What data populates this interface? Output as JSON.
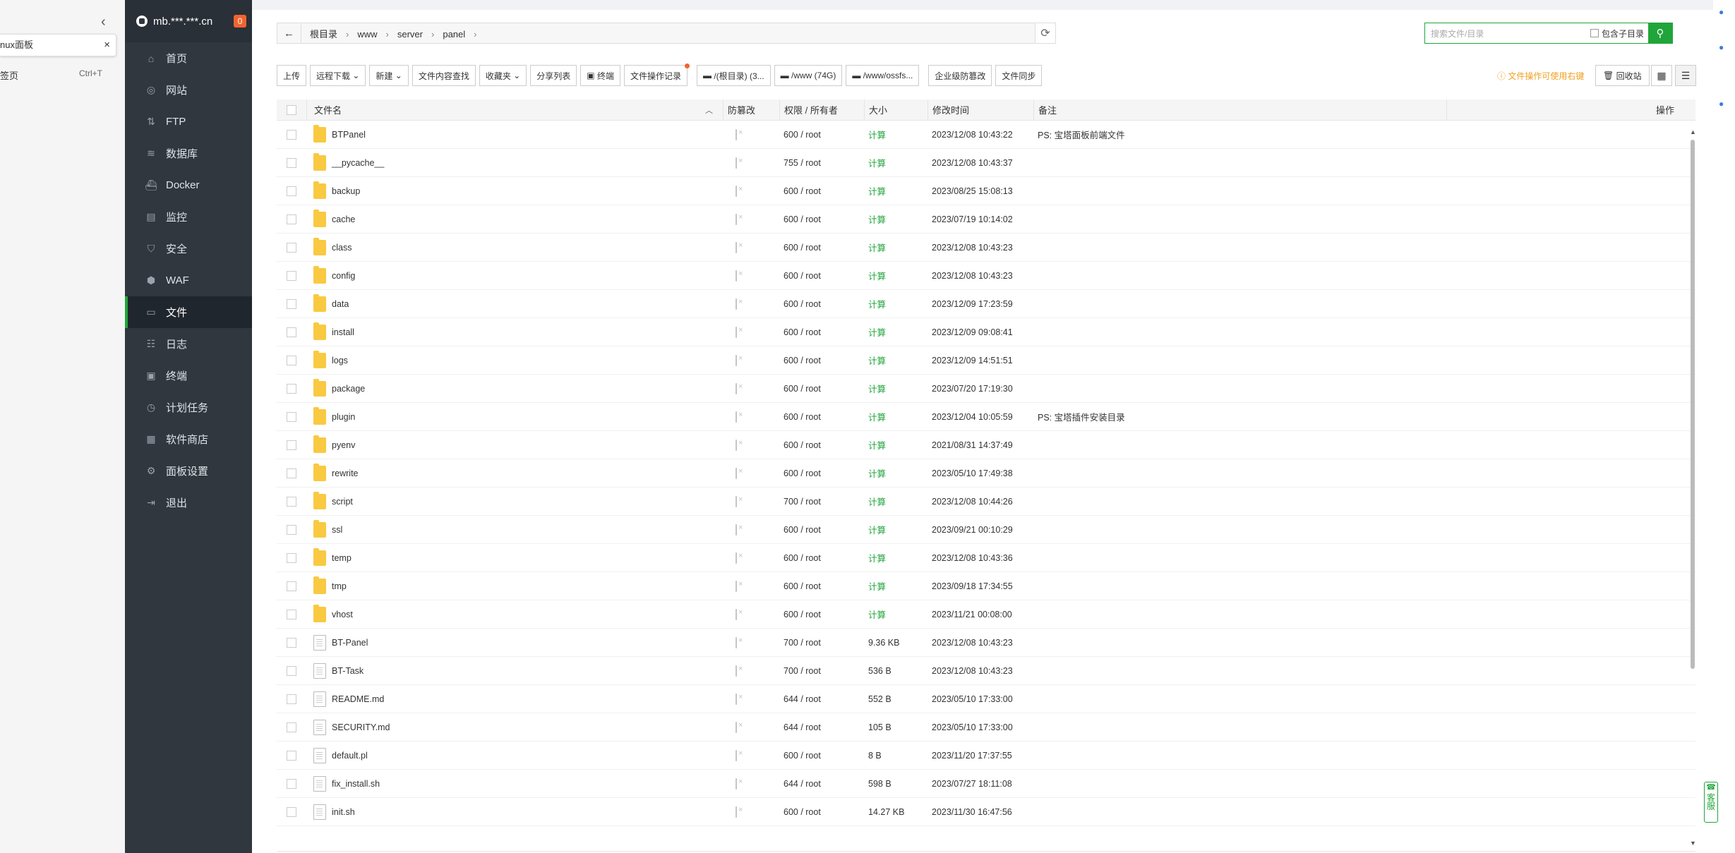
{
  "browser": {
    "tab_title": "nux面板",
    "new_tab_label": "签页",
    "new_tab_shortcut": "Ctrl+T"
  },
  "sidebar": {
    "host": "mb.***.***.cn",
    "badge": "0",
    "items": [
      {
        "label": "首页",
        "icon": "home-icon"
      },
      {
        "label": "网站",
        "icon": "globe-icon"
      },
      {
        "label": "FTP",
        "icon": "ftp-icon"
      },
      {
        "label": "数据库",
        "icon": "database-icon"
      },
      {
        "label": "Docker",
        "icon": "docker-icon"
      },
      {
        "label": "监控",
        "icon": "monitor-icon"
      },
      {
        "label": "安全",
        "icon": "shield-icon"
      },
      {
        "label": "WAF",
        "icon": "waf-icon"
      },
      {
        "label": "文件",
        "icon": "folder-icon",
        "active": true
      },
      {
        "label": "日志",
        "icon": "log-icon"
      },
      {
        "label": "终端",
        "icon": "terminal-icon"
      },
      {
        "label": "计划任务",
        "icon": "clock-icon"
      },
      {
        "label": "软件商店",
        "icon": "grid-icon"
      },
      {
        "label": "面板设置",
        "icon": "gear-icon"
      },
      {
        "label": "退出",
        "icon": "logout-icon"
      }
    ]
  },
  "breadcrumb": [
    "根目录",
    "www",
    "server",
    "panel"
  ],
  "search": {
    "placeholder": "搜索文件/目录",
    "subdir_label": "包含子目录"
  },
  "toolbar": {
    "upload": "上传",
    "remote_download": "远程下载",
    "new": "新建",
    "content_search": "文件内容查找",
    "favorites": "收藏夹",
    "share_list": "分享列表",
    "terminal": "终端",
    "op_log": "文件操作记录",
    "disk_root": "/(根目录) (3...",
    "disk_www": "/www (74G)",
    "disk_oss": "/www/ossfs...",
    "tamper": "企业级防篡改",
    "sync": "文件同步",
    "tips": "文件操作可使用右键",
    "recycle": "回收站"
  },
  "table": {
    "headers": {
      "name": "文件名",
      "protect": "防篡改",
      "perm": "权限 / 所有者",
      "size": "大小",
      "mtime": "修改时间",
      "note": "备注",
      "op": "操作"
    },
    "rows": [
      {
        "type": "folder",
        "name": "BTPanel",
        "perm": "600 / root",
        "size": "计算",
        "mtime": "2023/12/08 10:43:22",
        "note": "PS: 宝塔面板前端文件"
      },
      {
        "type": "folder",
        "name": "__pycache__",
        "perm": "755 / root",
        "size": "计算",
        "mtime": "2023/12/08 10:43:37",
        "note": ""
      },
      {
        "type": "folder",
        "name": "backup",
        "perm": "600 / root",
        "size": "计算",
        "mtime": "2023/08/25 15:08:13",
        "note": ""
      },
      {
        "type": "folder",
        "name": "cache",
        "perm": "600 / root",
        "size": "计算",
        "mtime": "2023/07/19 10:14:02",
        "note": ""
      },
      {
        "type": "folder",
        "name": "class",
        "perm": "600 / root",
        "size": "计算",
        "mtime": "2023/12/08 10:43:23",
        "note": ""
      },
      {
        "type": "folder",
        "name": "config",
        "perm": "600 / root",
        "size": "计算",
        "mtime": "2023/12/08 10:43:23",
        "note": ""
      },
      {
        "type": "folder",
        "name": "data",
        "perm": "600 / root",
        "size": "计算",
        "mtime": "2023/12/09 17:23:59",
        "note": ""
      },
      {
        "type": "folder",
        "name": "install",
        "perm": "600 / root",
        "size": "计算",
        "mtime": "2023/12/09 09:08:41",
        "note": ""
      },
      {
        "type": "folder",
        "name": "logs",
        "perm": "600 / root",
        "size": "计算",
        "mtime": "2023/12/09 14:51:51",
        "note": ""
      },
      {
        "type": "folder",
        "name": "package",
        "perm": "600 / root",
        "size": "计算",
        "mtime": "2023/07/20 17:19:30",
        "note": ""
      },
      {
        "type": "folder",
        "name": "plugin",
        "perm": "600 / root",
        "size": "计算",
        "mtime": "2023/12/04 10:05:59",
        "note": "PS: 宝塔插件安装目录"
      },
      {
        "type": "folder",
        "name": "pyenv",
        "perm": "600 / root",
        "size": "计算",
        "mtime": "2021/08/31 14:37:49",
        "note": ""
      },
      {
        "type": "folder",
        "name": "rewrite",
        "perm": "600 / root",
        "size": "计算",
        "mtime": "2023/05/10 17:49:38",
        "note": ""
      },
      {
        "type": "folder",
        "name": "script",
        "perm": "700 / root",
        "size": "计算",
        "mtime": "2023/12/08 10:44:26",
        "note": ""
      },
      {
        "type": "folder",
        "name": "ssl",
        "perm": "600 / root",
        "size": "计算",
        "mtime": "2023/09/21 00:10:29",
        "note": ""
      },
      {
        "type": "folder",
        "name": "temp",
        "perm": "600 / root",
        "size": "计算",
        "mtime": "2023/12/08 10:43:36",
        "note": ""
      },
      {
        "type": "folder",
        "name": "tmp",
        "perm": "600 / root",
        "size": "计算",
        "mtime": "2023/09/18 17:34:55",
        "note": ""
      },
      {
        "type": "folder",
        "name": "vhost",
        "perm": "600 / root",
        "size": "计算",
        "mtime": "2023/11/21 00:08:00",
        "note": ""
      },
      {
        "type": "file",
        "name": "BT-Panel",
        "perm": "700 / root",
        "size": "9.36 KB",
        "mtime": "2023/12/08 10:43:23",
        "note": ""
      },
      {
        "type": "file",
        "name": "BT-Task",
        "perm": "700 / root",
        "size": "536 B",
        "mtime": "2023/12/08 10:43:23",
        "note": ""
      },
      {
        "type": "file",
        "name": "README.md",
        "perm": "644 / root",
        "size": "552 B",
        "mtime": "2023/05/10 17:33:00",
        "note": ""
      },
      {
        "type": "file",
        "name": "SECURITY.md",
        "perm": "644 / root",
        "size": "105 B",
        "mtime": "2023/05/10 17:33:00",
        "note": ""
      },
      {
        "type": "file",
        "name": "default.pl",
        "perm": "600 / root",
        "size": "8 B",
        "mtime": "2023/11/20 17:37:55",
        "note": ""
      },
      {
        "type": "file",
        "name": "fix_install.sh",
        "perm": "644 / root",
        "size": "598 B",
        "mtime": "2023/07/27 18:11:08",
        "note": ""
      },
      {
        "type": "file",
        "name": "init.sh",
        "perm": "600 / root",
        "size": "14.27 KB",
        "mtime": "2023/11/30 16:47:56",
        "note": ""
      }
    ]
  },
  "kefu": "客服",
  "colors": {
    "accent": "#20a53a",
    "sidebar_bg": "#30373f",
    "badge": "#f0642e"
  }
}
